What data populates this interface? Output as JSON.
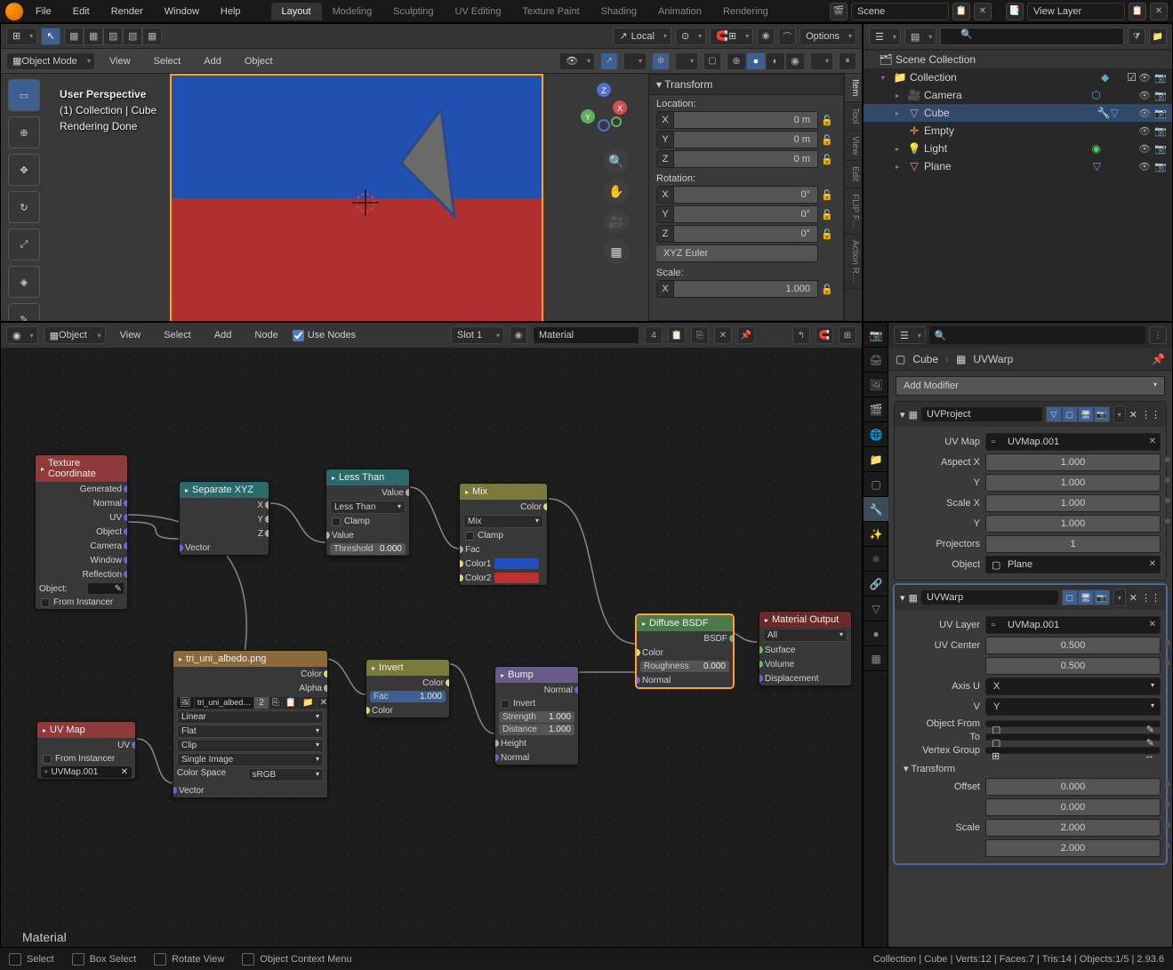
{
  "menu": [
    "File",
    "Edit",
    "Render",
    "Window",
    "Help"
  ],
  "workspaces": [
    "Layout",
    "Modeling",
    "Sculpting",
    "UV Editing",
    "Texture Paint",
    "Shading",
    "Animation",
    "Rendering"
  ],
  "active_ws": 0,
  "scene_name": "Scene",
  "layer_name": "View Layer",
  "vp": {
    "mode": "Object Mode",
    "orient": "Local",
    "options": "Options",
    "header_menus": [
      "View",
      "Select",
      "Add",
      "Object"
    ],
    "overlay": {
      "line1": "User Perspective",
      "line2": "(1) Collection | Cube",
      "line3": "Rendering Done"
    }
  },
  "npanel": {
    "title": "Transform",
    "tabs": [
      "Item",
      "Tool",
      "View",
      "Edit",
      "FLIP F…",
      "Action R…"
    ],
    "loc_label": "Location:",
    "rot_label": "Rotation:",
    "scale_label": "Scale:",
    "loc": {
      "x": "0 m",
      "y": "0 m",
      "z": "0 m"
    },
    "rot": {
      "x": "0°",
      "y": "0°",
      "z": "0°"
    },
    "rot_mode": "XYZ Euler",
    "scale": {
      "x": "1.000"
    }
  },
  "outliner": {
    "root": "Scene Collection",
    "items": [
      {
        "name": "Collection",
        "icon": "📁",
        "depth": 1,
        "check": true
      },
      {
        "name": "Camera",
        "icon": "🎥",
        "depth": 2
      },
      {
        "name": "Cube",
        "icon": "▽",
        "depth": 2,
        "sel": true
      },
      {
        "name": "Empty",
        "icon": "＋",
        "depth": 2
      },
      {
        "name": "Light",
        "icon": "💡",
        "depth": 2
      },
      {
        "name": "Plane",
        "icon": "▽",
        "depth": 2
      }
    ]
  },
  "node_editor": {
    "mode": "Object",
    "menus": [
      "View",
      "Select",
      "Add",
      "Node"
    ],
    "use_nodes_label": "Use Nodes",
    "slot": "Slot 1",
    "material": "Material",
    "users": "4",
    "label": "Material"
  },
  "nodes": {
    "texcoord": {
      "title": "Texture Coordinate",
      "outs": [
        "Generated",
        "Normal",
        "UV",
        "Object",
        "Camera",
        "Window",
        "Reflection"
      ],
      "obj_label": "Object:",
      "from_inst": "From Instancer"
    },
    "sepxyz": {
      "title": "Separate XYZ",
      "outs": [
        "X",
        "Y",
        "Z"
      ],
      "in": "Vector"
    },
    "lessthan": {
      "title": "Less Than",
      "out": "Value",
      "mode": "Less Than",
      "clamp": "Clamp",
      "in": "Value",
      "thresh_l": "Threshold",
      "thresh_v": "0.000"
    },
    "mix": {
      "title": "Mix",
      "out": "Color",
      "mode": "Mix",
      "clamp": "Clamp",
      "fac": "Fac",
      "c1": "Color1",
      "c2": "Color2",
      "c1v": "#2050c0",
      "c2v": "#c03030"
    },
    "uvmap": {
      "title": "UV Map",
      "out": "UV",
      "from_inst": "From Instancer",
      "map": "UVMap.001"
    },
    "imgtex": {
      "title": "tri_uni_albedo.png",
      "outs": [
        "Color",
        "Alpha"
      ],
      "file": "tri_uni_albed…",
      "users": "2",
      "interp": "Linear",
      "proj": "Flat",
      "ext": "Clip",
      "src": "Single Image",
      "cs_l": "Color Space",
      "cs_v": "sRGB",
      "in": "Vector"
    },
    "invert": {
      "title": "Invert",
      "out": "Color",
      "fac_l": "Fac",
      "fac_v": "1.000",
      "in": "Color"
    },
    "bump": {
      "title": "Bump",
      "out": "Normal",
      "inv": "Invert",
      "str_l": "Strength",
      "str_v": "1.000",
      "dist_l": "Distance",
      "dist_v": "1.000",
      "ins": [
        "Height",
        "Normal"
      ]
    },
    "diffuse": {
      "title": "Diffuse BSDF",
      "out": "BSDF",
      "color": "Color",
      "rough_l": "Roughness",
      "rough_v": "0.000",
      "normal": "Normal"
    },
    "matout": {
      "title": "Material Output",
      "mode": "All",
      "ins": [
        "Surface",
        "Volume",
        "Displacement"
      ]
    }
  },
  "props": {
    "search_ph": "",
    "bc": {
      "obj": "Cube",
      "mod": "UVWarp"
    },
    "add_mod": "Add Modifier",
    "uvproject": {
      "name": "UVProject",
      "uvmap_l": "UV Map",
      "uvmap_v": "UVMap.001",
      "aspx_l": "Aspect X",
      "aspx_v": "1.000",
      "y_l": "Y",
      "aspy_v": "1.000",
      "sclx_l": "Scale X",
      "sclx_v": "1.000",
      "scly_v": "1.000",
      "proj_l": "Projectors",
      "proj_v": "1",
      "obj_l": "Object",
      "obj_v": "Plane"
    },
    "uvwarp": {
      "name": "UVWarp",
      "uvlayer_l": "UV Layer",
      "uvlayer_v": "UVMap.001",
      "center_l": "UV Center",
      "cx": "0.500",
      "cy": "0.500",
      "axu_l": "Axis U",
      "axu_v": "X",
      "axv_l": "V",
      "axv_v": "Y",
      "from_l": "Object From",
      "to_l": "To",
      "vg_l": "Vertex Group",
      "xform": "Transform",
      "off_l": "Offset",
      "ox": "0.000",
      "oy": "0.000",
      "scl_l": "Scale",
      "sx": "2.000",
      "sy": "2.000"
    }
  },
  "status": {
    "kb": [
      {
        "icon": "🖱",
        "label": "Select"
      },
      {
        "icon": "🖱",
        "label": "Box Select"
      },
      {
        "icon": "🖱",
        "label": "Rotate View"
      },
      {
        "icon": "📋",
        "label": "Object Context Menu"
      }
    ],
    "stats": "Collection | Cube | Verts:12 | Faces:7 | Tris:14 | Objects:1/5 | 2.93.6"
  }
}
